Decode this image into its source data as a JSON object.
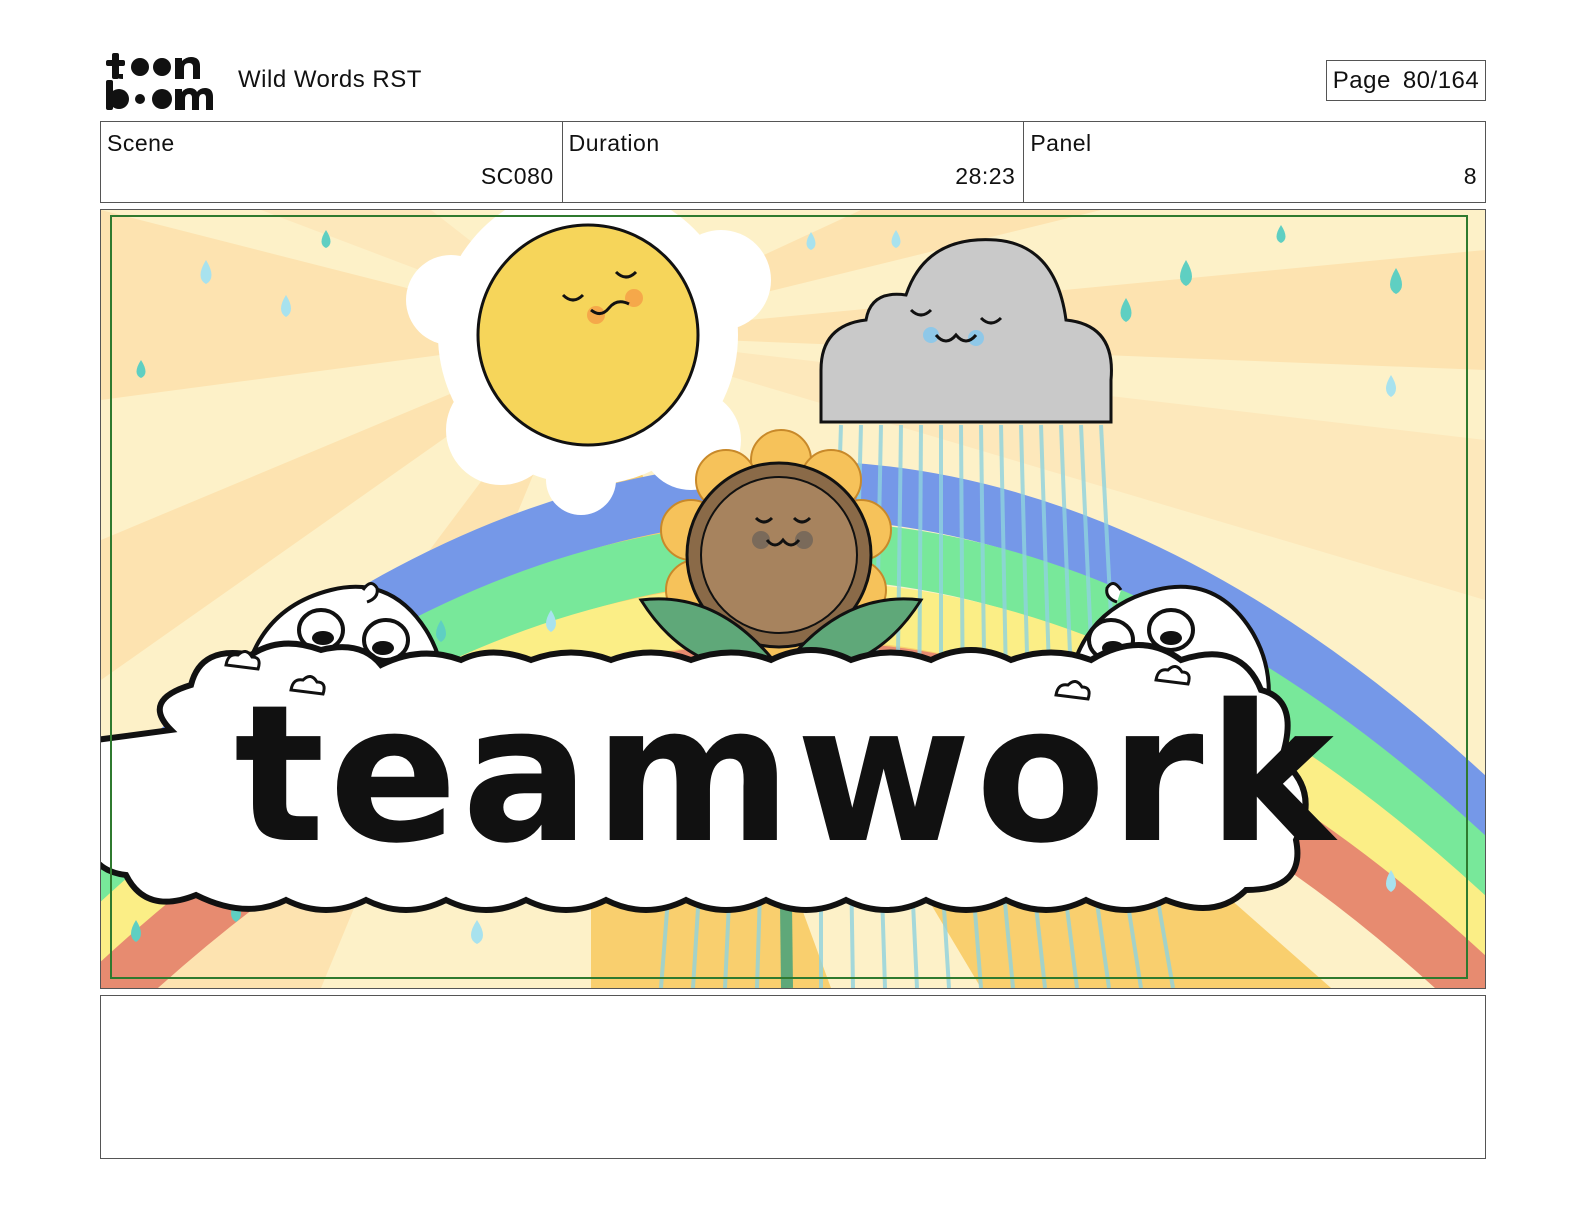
{
  "header": {
    "logo_text": "toonboom",
    "project_title": "Wild Words RST",
    "page_label": "Page",
    "page_value": "80/164"
  },
  "info": {
    "scene_label": "Scene",
    "scene_value": "SC080",
    "duration_label": "Duration",
    "duration_value": "28:23",
    "panel_label": "Panel",
    "panel_value": "8"
  },
  "panel": {
    "word": "teamwork"
  },
  "caption": {
    "text": ""
  },
  "colors": {
    "rainbow_blue": "#7598e8",
    "rainbow_green": "#78e89a",
    "rainbow_yellow": "#fbee86",
    "rainbow_red": "#e78b70",
    "sun": "#f6d55a",
    "cloud": "#c9c9c9",
    "sunflower_center": "#a7835e",
    "petals": "#f6c25a",
    "leaves": "#5fa879",
    "drops": "#5fcfc2",
    "safe_frame": "#2f7a2f"
  }
}
